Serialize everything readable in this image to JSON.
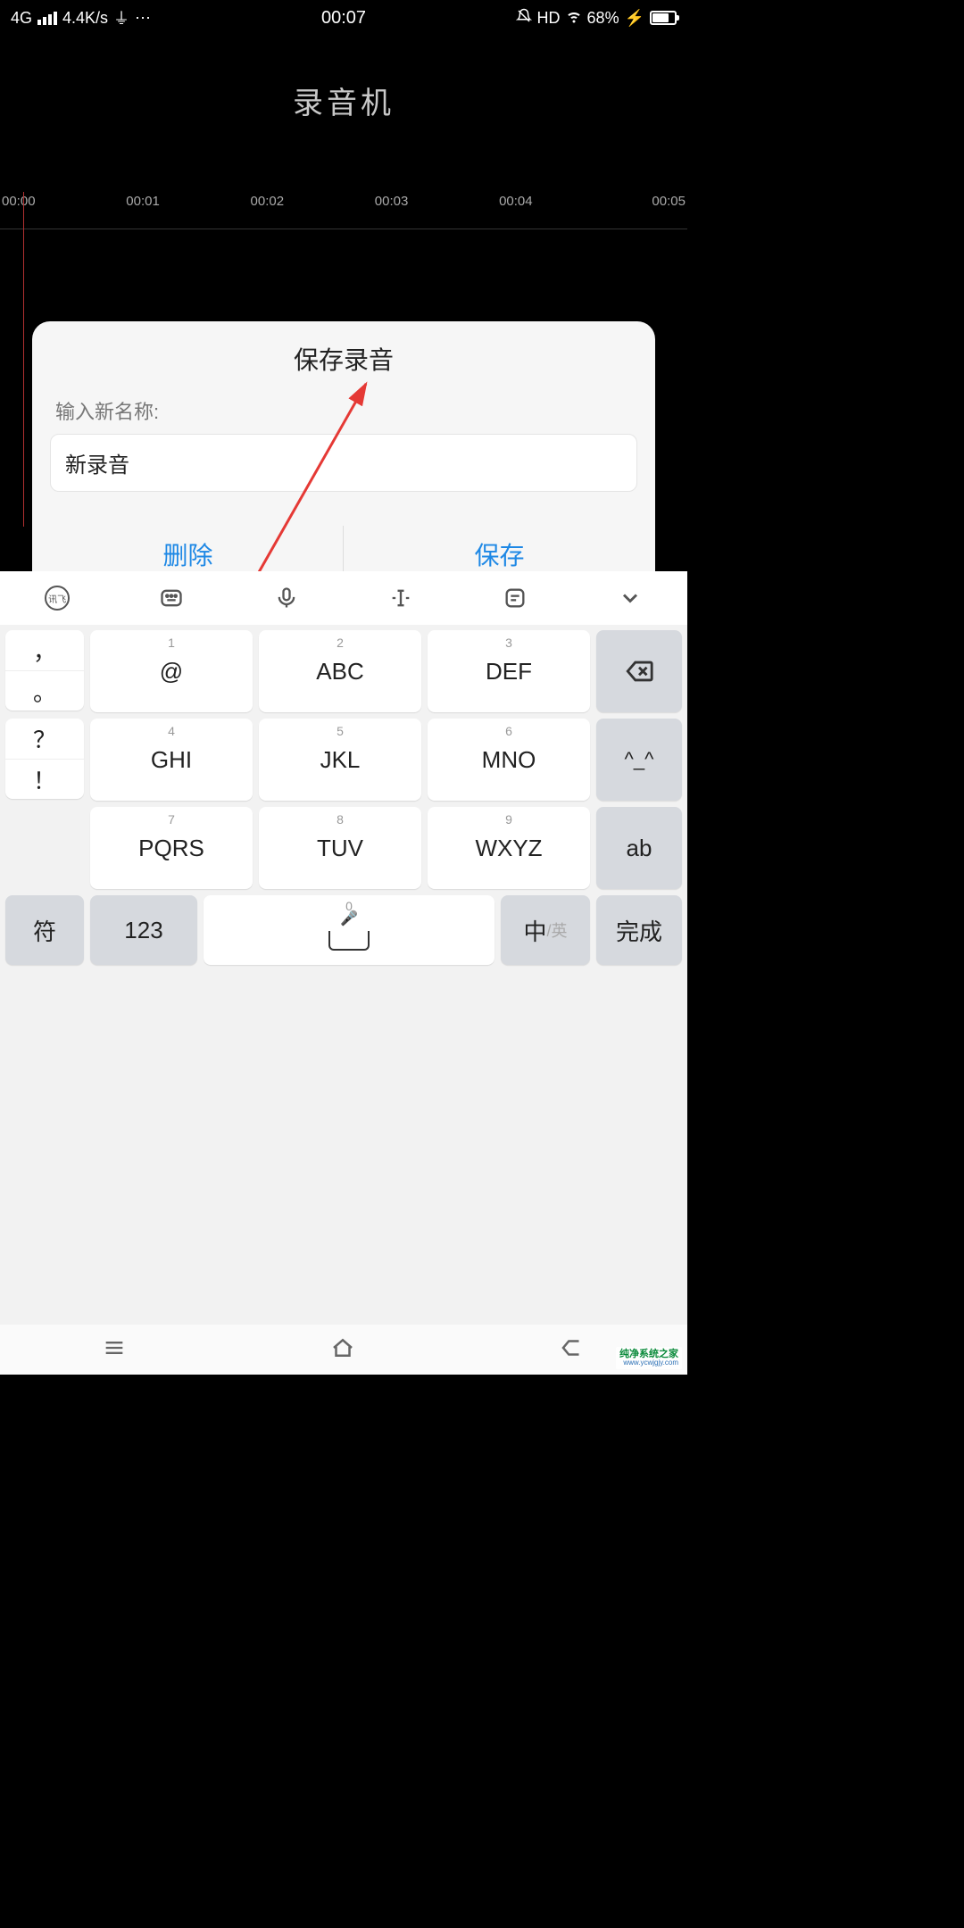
{
  "status": {
    "network": "4G",
    "speed": "4.4K/s",
    "time": "00:07",
    "hd": "HD",
    "battery_pct": "68%"
  },
  "app": {
    "title": "录音机"
  },
  "timeline": [
    "00:00",
    "00:01",
    "00:02",
    "00:03",
    "00:04",
    "00:05"
  ],
  "dialog": {
    "title": "保存录音",
    "label": "输入新名称:",
    "value": "新录音",
    "delete": "删除",
    "save": "保存"
  },
  "keyboard": {
    "rows": [
      [
        {
          "num": "1",
          "main": "@"
        },
        {
          "num": "2",
          "main": "ABC"
        },
        {
          "num": "3",
          "main": "DEF"
        }
      ],
      [
        {
          "num": "4",
          "main": "GHI"
        },
        {
          "num": "5",
          "main": "JKL"
        },
        {
          "num": "6",
          "main": "MNO"
        }
      ],
      [
        {
          "num": "7",
          "main": "PQRS"
        },
        {
          "num": "8",
          "main": "TUV"
        },
        {
          "num": "9",
          "main": "WXYZ"
        }
      ]
    ],
    "left": {
      "comma": "，",
      "period": "。",
      "question": "？",
      "exclaim": "！"
    },
    "right": {
      "face": "^_^",
      "ab": "ab"
    },
    "bottom": {
      "sym": "符",
      "num": "123",
      "space_num": "0",
      "zh": "中",
      "en": "/英",
      "done": "完成"
    }
  },
  "watermark": {
    "line1": "纯净系统之家",
    "line2": "www.ycwjgjy.com"
  }
}
